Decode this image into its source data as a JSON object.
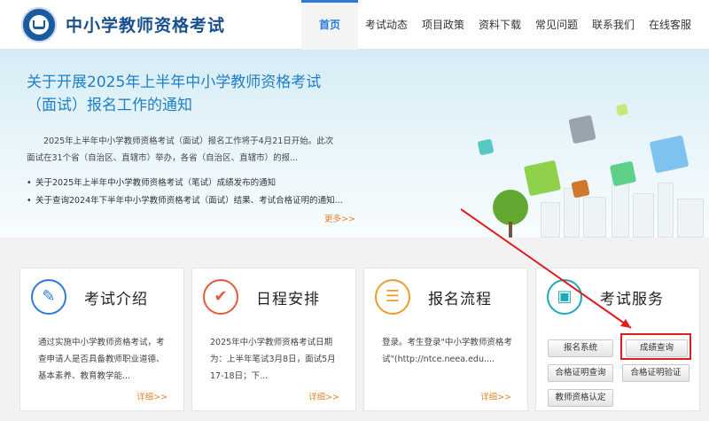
{
  "header": {
    "site_title": "中小学教师资格考试",
    "nav": [
      {
        "label": "首页",
        "active": true
      },
      {
        "label": "考试动态",
        "active": false
      },
      {
        "label": "项目政策",
        "active": false
      },
      {
        "label": "资料下载",
        "active": false
      },
      {
        "label": "常见问题",
        "active": false
      },
      {
        "label": "联系我们",
        "active": false
      },
      {
        "label": "在线客服",
        "active": false
      }
    ]
  },
  "banner": {
    "title": "关于开展2025年上半年中小学教师资格考试（面试）报名工作的通知",
    "description": "2025年上半年中小学教师资格考试（面试）报名工作将于4月21日开始。此次面试在31个省（自治区、直辖市）举办，各省（自治区、直辖市）的报...",
    "news": [
      "关于2025年上半年中小学教师资格考试（笔试）成绩发布的通知",
      "关于查询2024年下半年中小学教师资格考试（面试）结果、考试合格证明的通知..."
    ],
    "more": "更多>>"
  },
  "cards": [
    {
      "title": "考试介绍",
      "icon": "document-edit-icon",
      "text": "通过实施中小学教师资格考试，考查申请人是否具备教师职业道德、基本素养、教育教学能...",
      "more": "详细>>"
    },
    {
      "title": "日程安排",
      "icon": "checkmark-icon",
      "text": "2025年中小学教师资格考试日期为：上半年笔试3月8日，面试5月17-18日；下...",
      "more": "详细>>"
    },
    {
      "title": "报名流程",
      "icon": "form-list-icon",
      "text": "登录。考生登录\"中小学教师资格考试\"(http://ntce.neea.edu....",
      "more": "详细>>"
    },
    {
      "title": "考试服务",
      "icon": "contact-book-icon",
      "buttons": [
        "报名系统",
        "成绩查询",
        "合格证明查询",
        "合格证明验证",
        "教师资格认定"
      ]
    }
  ],
  "colors": {
    "brand_blue": "#1a4f8e",
    "accent_blue": "#2c7bd6",
    "link_orange": "#e5822b",
    "highlight_red": "#e21b1b"
  }
}
